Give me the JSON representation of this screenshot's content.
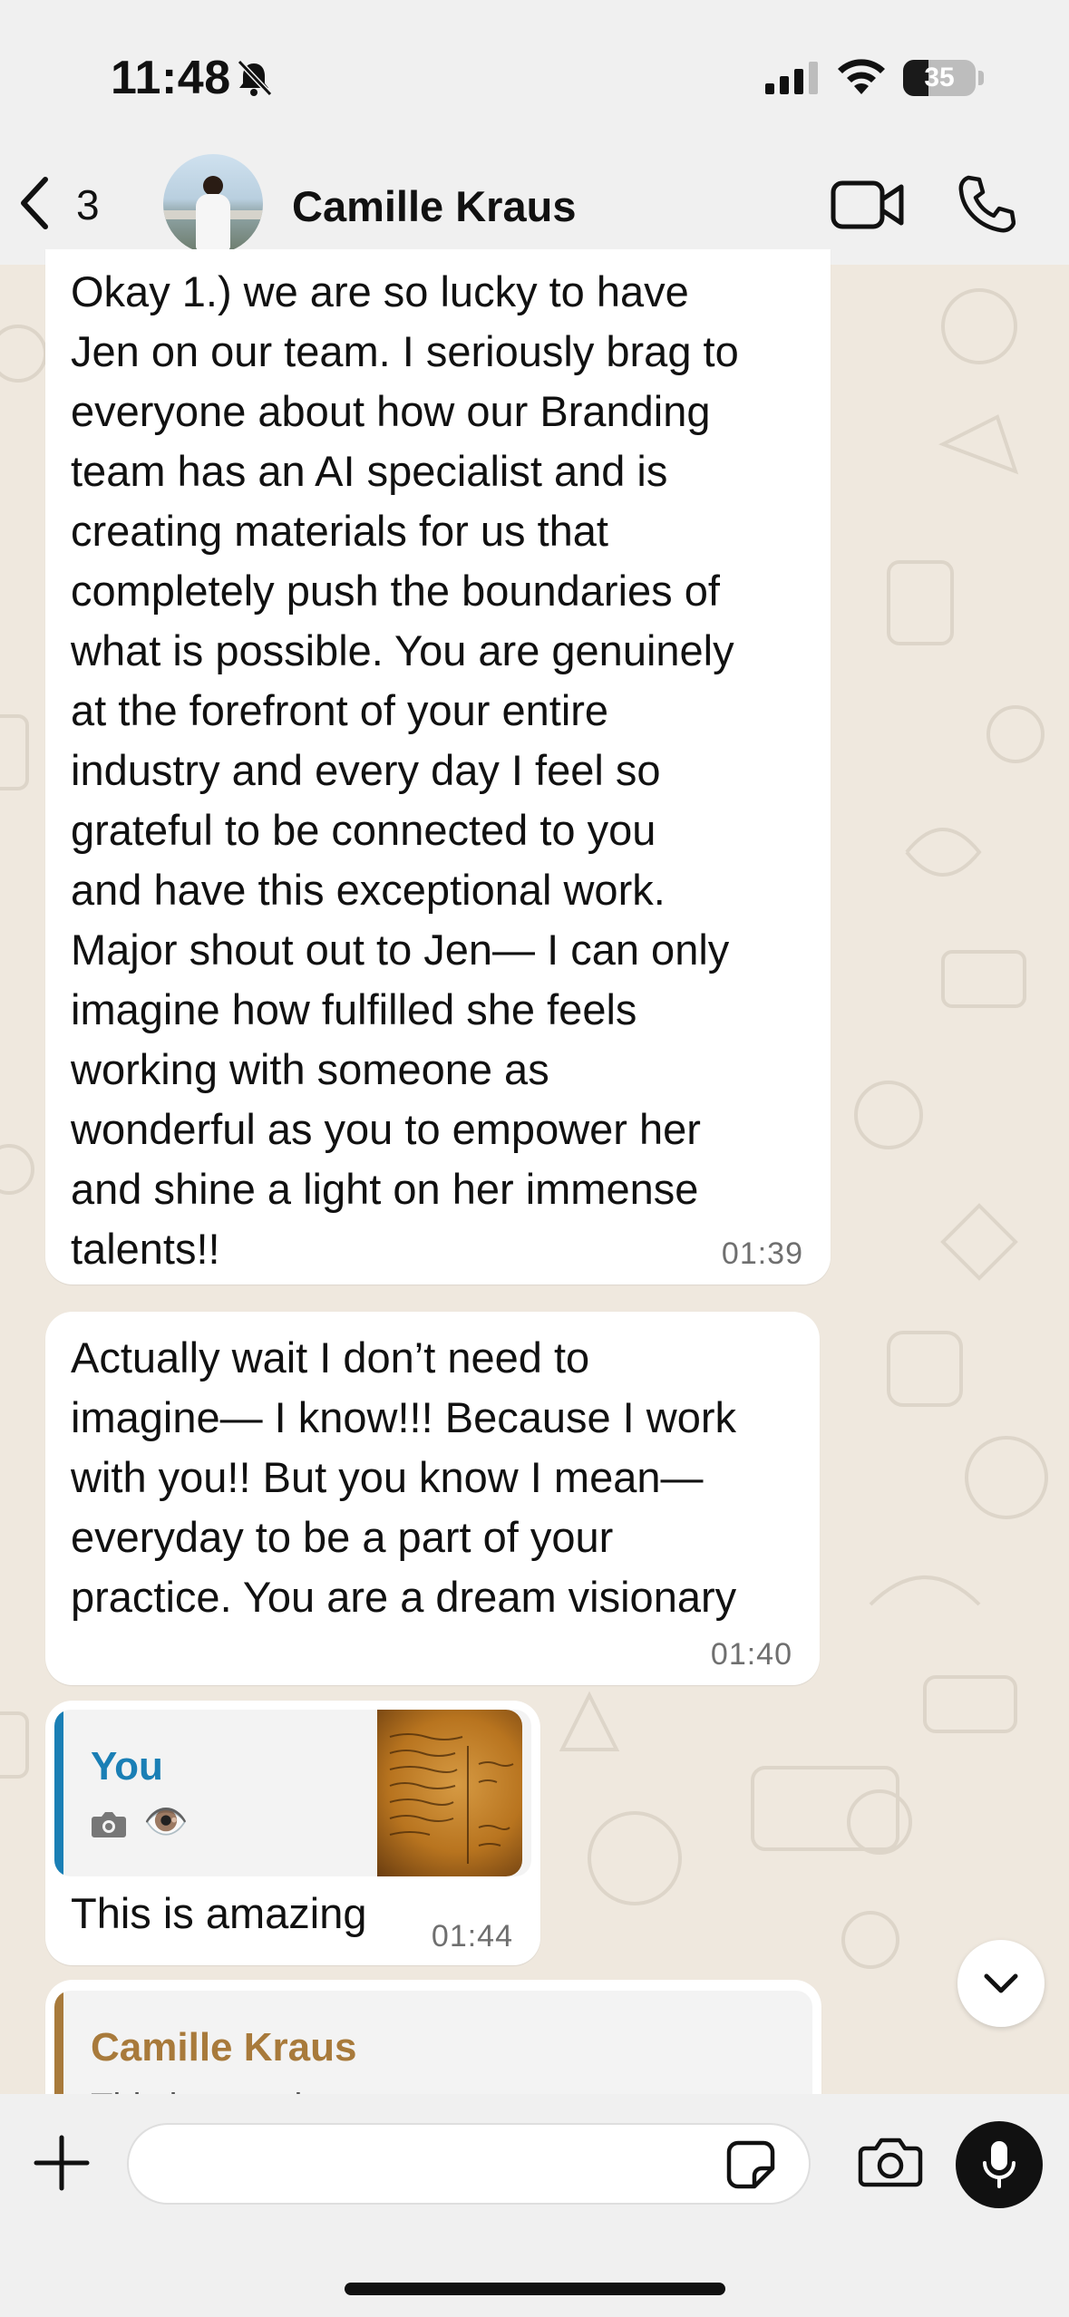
{
  "status_bar": {
    "time": "11:48",
    "battery_level": "35",
    "battery_fraction": 0.35
  },
  "header": {
    "back_count": "3",
    "contact_name": "Camille Kraus"
  },
  "messages": [
    {
      "text": "Okay 1.) we are so lucky to have\nJen on our team. I seriously brag to\neveryone about how our Branding\nteam has an AI specialist and is\ncreating materials for us that\ncompletely push the boundaries of\nwhat is possible. You are genuinely\nat the forefront of your entire\nindustry and every day I feel so\ngrateful to be connected to you\nand have this exceptional work.\nMajor shout out to Jen— I can only\nimagine how fulfilled she feels\nworking with someone as\nwonderful as you to empower her\nand shine a light on her immense\ntalents!!",
      "time": "01:39"
    },
    {
      "text": "Actually wait I don’t need to\nimagine— I know!!! Because I work\nwith you!! But you know I mean—\neveryday to be a part of your\npractice. You are a dream visionary",
      "time": "01:40"
    },
    {
      "quote_author": "You",
      "quote_eye": "👁️",
      "text": "This is amazing",
      "time": "01:44"
    },
    {
      "quote_author": "Camille Kraus",
      "quote_text": "This is amazing"
    }
  ],
  "composer": {
    "placeholder": ""
  },
  "colors": {
    "header_bg": "#f0f0f0",
    "wallpaper": "#efe8de",
    "bubble": "#ffffff",
    "you_quote_accent": "#1a7fb5",
    "camille_quote_accent": "#a87a3b"
  },
  "icons": [
    "bell-slash-icon",
    "signal-icon",
    "wifi-icon",
    "battery-icon",
    "back-chevron-icon",
    "video-camera-icon",
    "phone-icon",
    "camera-icon",
    "chevron-down-icon",
    "plus-icon",
    "sticker-icon",
    "mic-icon"
  ]
}
